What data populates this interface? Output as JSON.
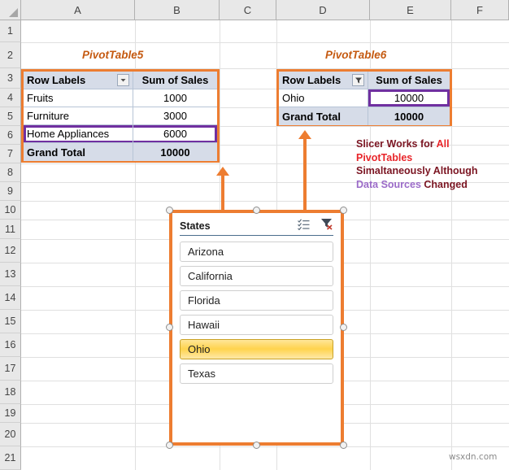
{
  "grid": {
    "columns": [
      "A",
      "B",
      "C",
      "D",
      "E",
      "F"
    ],
    "rows": [
      "1",
      "2",
      "3",
      "4",
      "5",
      "6",
      "7",
      "8",
      "9",
      "10",
      "11",
      "12",
      "13",
      "14",
      "15",
      "16",
      "17",
      "18",
      "19",
      "20",
      "21"
    ]
  },
  "pivot1": {
    "title": "PivotTable5",
    "header": [
      "Row Labels",
      "Sum of Sales"
    ],
    "rows": [
      {
        "label": "Fruits",
        "value": "1000"
      },
      {
        "label": "Furniture",
        "value": "3000"
      },
      {
        "label": "Home Appliances",
        "value": "6000"
      }
    ],
    "total": {
      "label": "Grand Total",
      "value": "10000"
    },
    "filter_icon": "dropdown-arrow-icon",
    "highlight_row_index": 2,
    "highlight_color": "#7030A0",
    "border_color": "#ED7D31"
  },
  "pivot2": {
    "title": "PivotTable6",
    "header": [
      "Row Labels",
      "Sum of Sales"
    ],
    "rows": [
      {
        "label": "Ohio",
        "value": "10000"
      }
    ],
    "total": {
      "label": "Grand Total",
      "value": "10000"
    },
    "filter_icon": "funnel-filter-icon",
    "highlight_value_color": "#7030A0",
    "border_color": "#ED7D31"
  },
  "annotation": {
    "line1_a": "Slicer Works for ",
    "line1_b": "All",
    "line2": "PivotTables",
    "line3": "Simaltaneously Although",
    "line4_a": "Data Sources ",
    "line4_b": "Changed",
    "dark_color": "#7B1522",
    "red_color": "#E8252A",
    "purple_color": "#9B6BC8"
  },
  "slicer": {
    "title": "States",
    "multiselect_icon": "multi-select-checklist-icon",
    "clearfilter_icon": "clear-filter-icon",
    "items": [
      {
        "label": "Arizona",
        "selected": false
      },
      {
        "label": "California",
        "selected": false
      },
      {
        "label": "Florida",
        "selected": false
      },
      {
        "label": "Hawaii",
        "selected": false
      },
      {
        "label": "Ohio",
        "selected": true
      },
      {
        "label": "Texas",
        "selected": false
      }
    ],
    "selection_color": "#FFD34D",
    "frame_color": "#ED7D31"
  },
  "watermark": "wsxdn.com"
}
